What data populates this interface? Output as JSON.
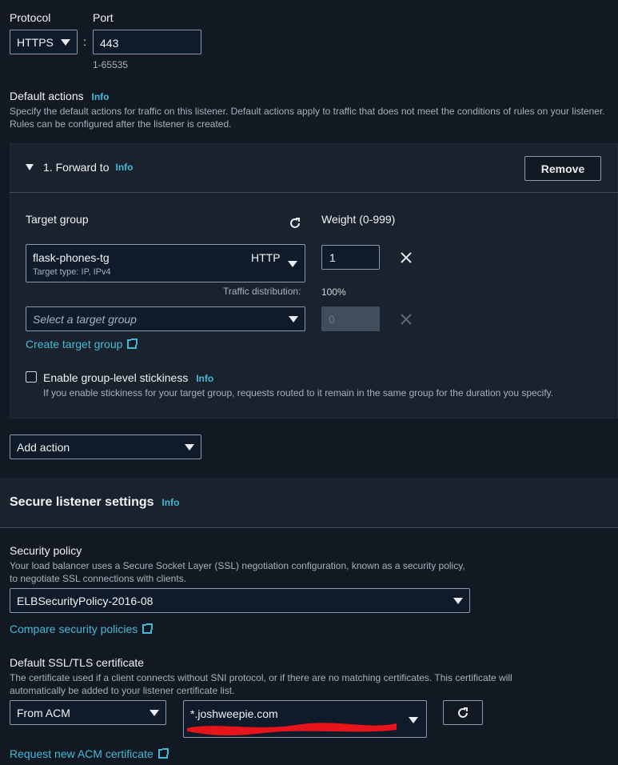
{
  "listener": {
    "protocol_label": "Protocol",
    "protocol_value": "HTTPS",
    "separator": ":",
    "port_label": "Port",
    "port_value": "443",
    "port_hint": "1-65535"
  },
  "default_actions": {
    "title": "Default actions",
    "info": "Info",
    "description": "Specify the default actions for traffic on this listener. Default actions apply to traffic that does not meet the conditions of rules on your listener. Rules can be configured after the listener is created.",
    "action": {
      "title": "1. Forward to",
      "info": "Info",
      "remove_label": "Remove",
      "target_group_label": "Target group",
      "weight_label": "Weight (0-999)",
      "rows": [
        {
          "name": "flask-phones-tg",
          "protocol": "HTTP",
          "subtitle": "Target type: IP, IPv4",
          "weight": "1"
        },
        {
          "placeholder": "Select a target group",
          "weight": "0"
        }
      ],
      "traffic_distribution_label": "Traffic distribution:",
      "traffic_distribution_value": "100%",
      "create_target_group": "Create target group",
      "stickiness_label": "Enable group-level stickiness",
      "stickiness_info": "Info",
      "stickiness_desc": "If you enable stickiness for your target group, requests routed to it remain in the same group for the duration you specify."
    },
    "add_action_label": "Add action"
  },
  "secure": {
    "title": "Secure listener settings",
    "info": "Info",
    "policy_label": "Security policy",
    "policy_desc": "Your load balancer uses a Secure Socket Layer (SSL) negotiation configuration, known as a security policy, to negotiate SSL connections with clients.",
    "policy_value": "ELBSecurityPolicy-2016-08",
    "compare_link": "Compare security policies",
    "cert_label": "Default SSL/TLS certificate",
    "cert_desc": "The certificate used if a client connects without SNI protocol, or if there are no matching certificates. This certificate will automatically be added to your listener certificate list.",
    "cert_source": "From ACM",
    "cert_value": "*.joshweepie.com",
    "request_link": "Request new ACM certificate"
  }
}
